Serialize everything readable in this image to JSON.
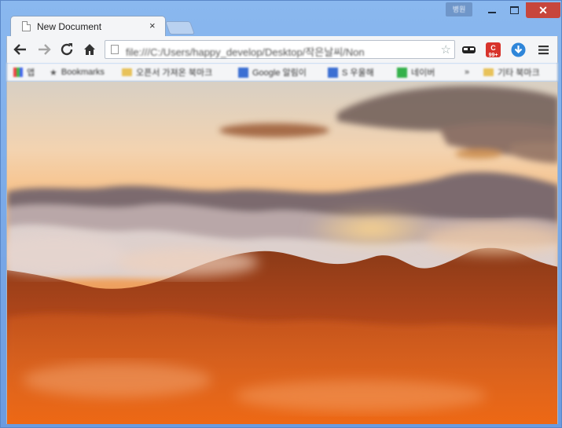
{
  "window": {
    "user_chip": "병원",
    "accent_color": "#c7463c"
  },
  "tab": {
    "title": "New Document",
    "close_label": "×"
  },
  "toolbar": {
    "url": "file:///C:/Users/happy_develop/Desktop/작은날씨/Non",
    "icons": [
      "back-arrow-icon",
      "forward-arrow-icon",
      "reload-icon",
      "home-icon",
      "page-icon",
      "star-icon",
      "mask-extension-icon",
      "badge-extension-icon",
      "download-extension-icon",
      "menu-icon"
    ],
    "badge_count": "99+"
  },
  "bookmarks": {
    "items": [
      {
        "label": "앱",
        "icon": "apps-icon"
      },
      {
        "label": "Bookmarks",
        "icon": "star-icon"
      },
      {
        "label": "오픈서 가져온 북마크",
        "icon": "folder-icon"
      },
      {
        "label": "Google 알림이",
        "icon": "blue-app-icon"
      },
      {
        "label": "S 우울해",
        "icon": "blue-app-icon"
      },
      {
        "label": "네이버",
        "icon": "green-app-icon"
      },
      {
        "label": "기타 북마크",
        "icon": "folder-icon"
      }
    ]
  }
}
